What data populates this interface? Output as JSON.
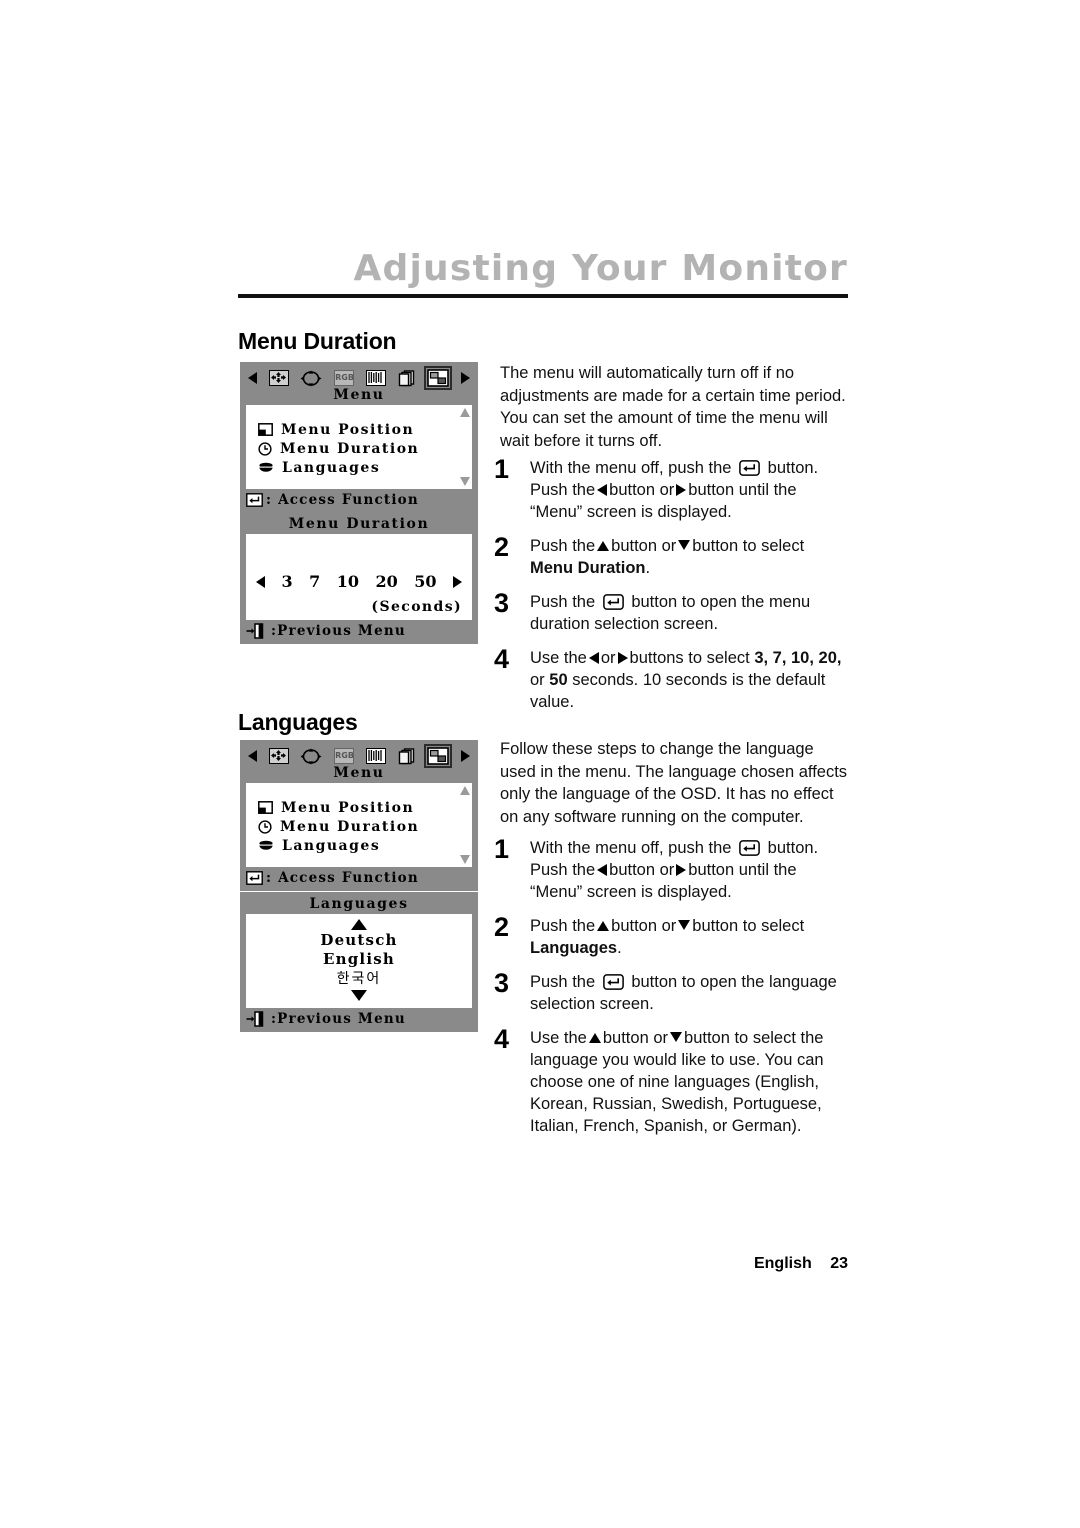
{
  "header": {
    "title": "Adjusting Your Monitor"
  },
  "sections": {
    "menu_duration": {
      "heading": "Menu Duration",
      "intro": "The menu will automatically turn off if no adjustments are made for a certain time period. You can set the amount of time the menu will wait before it turns off.",
      "steps": [
        {
          "num": "1",
          "pre": "With the menu off, push the",
          "mid": "button. Push the",
          "mid2": "button or",
          "post": "button until the “Menu” screen is displayed."
        },
        {
          "num": "2",
          "pre": "Push the",
          "mid": "button or",
          "post": "button to select",
          "bold": "Menu Duration",
          "tail": "."
        },
        {
          "num": "3",
          "pre": "Push the",
          "post": "button to open the menu duration selection screen."
        },
        {
          "num": "4",
          "pre": "Use the",
          "mid": "or",
          "post": "buttons to select",
          "bold1": "3, 7, 10, 20,",
          "mid3": "or",
          "bold2": "50",
          "tail": "seconds. 10 seconds is the default value."
        }
      ]
    },
    "languages": {
      "heading": "Languages",
      "intro": "Follow these steps to change the language used in the menu. The language chosen affects only the language of the OSD. It has no effect on any software running on the computer.",
      "steps": [
        {
          "num": "1",
          "pre": "With the menu off, push the",
          "mid": "button. Push the",
          "mid2": "button or",
          "post": "button until the “Menu” screen is displayed."
        },
        {
          "num": "2",
          "pre": "Push the",
          "mid": "button or",
          "post": "button to select",
          "bold": "Languages",
          "tail": "."
        },
        {
          "num": "3",
          "pre": "Push the",
          "post": "button to open the language selection screen."
        },
        {
          "num": "4",
          "pre": "Use the",
          "mid": "button or",
          "post": "button to select the language you would like to use. You can choose one of nine languages (English, Korean, Russian, Swedish, Portuguese, Italian, French, Spanish, or German)."
        }
      ]
    }
  },
  "osd": {
    "iconbar": [
      "left-arrow-icon",
      "position-icon",
      "size-icon",
      "rgb-icon",
      "moire-icon",
      "osd-pages-icon",
      "menu-icon",
      "right-arrow-icon"
    ],
    "rgb_label": "RGB",
    "menu_screen": {
      "title": "Menu",
      "items": [
        {
          "icon": "window-layout-icon",
          "label": "Menu Position"
        },
        {
          "icon": "clock-icon",
          "label": "Menu Duration"
        },
        {
          "icon": "speech-icon",
          "label": "Languages"
        }
      ],
      "footer": ": Access Function",
      "footer_icon": "enter-key-icon"
    },
    "duration_screen": {
      "title": "Menu Duration",
      "values": [
        "3",
        "7",
        "10",
        "20",
        "50"
      ],
      "unit": "(Seconds)",
      "footer": ":Previous Menu",
      "footer_icon": "exit-door-icon"
    },
    "languages_screen": {
      "title": "Languages",
      "items": [
        "Deutsch",
        "English",
        "한국어"
      ],
      "footer": ":Previous Menu",
      "footer_icon": "exit-door-icon"
    }
  },
  "footer": {
    "language": "English",
    "page": "23"
  },
  "colors": {
    "header_gray": "#b3b3b3",
    "osd_background": "#8a8a8a",
    "osd_screen": "#ffffff",
    "text": "#000000"
  }
}
